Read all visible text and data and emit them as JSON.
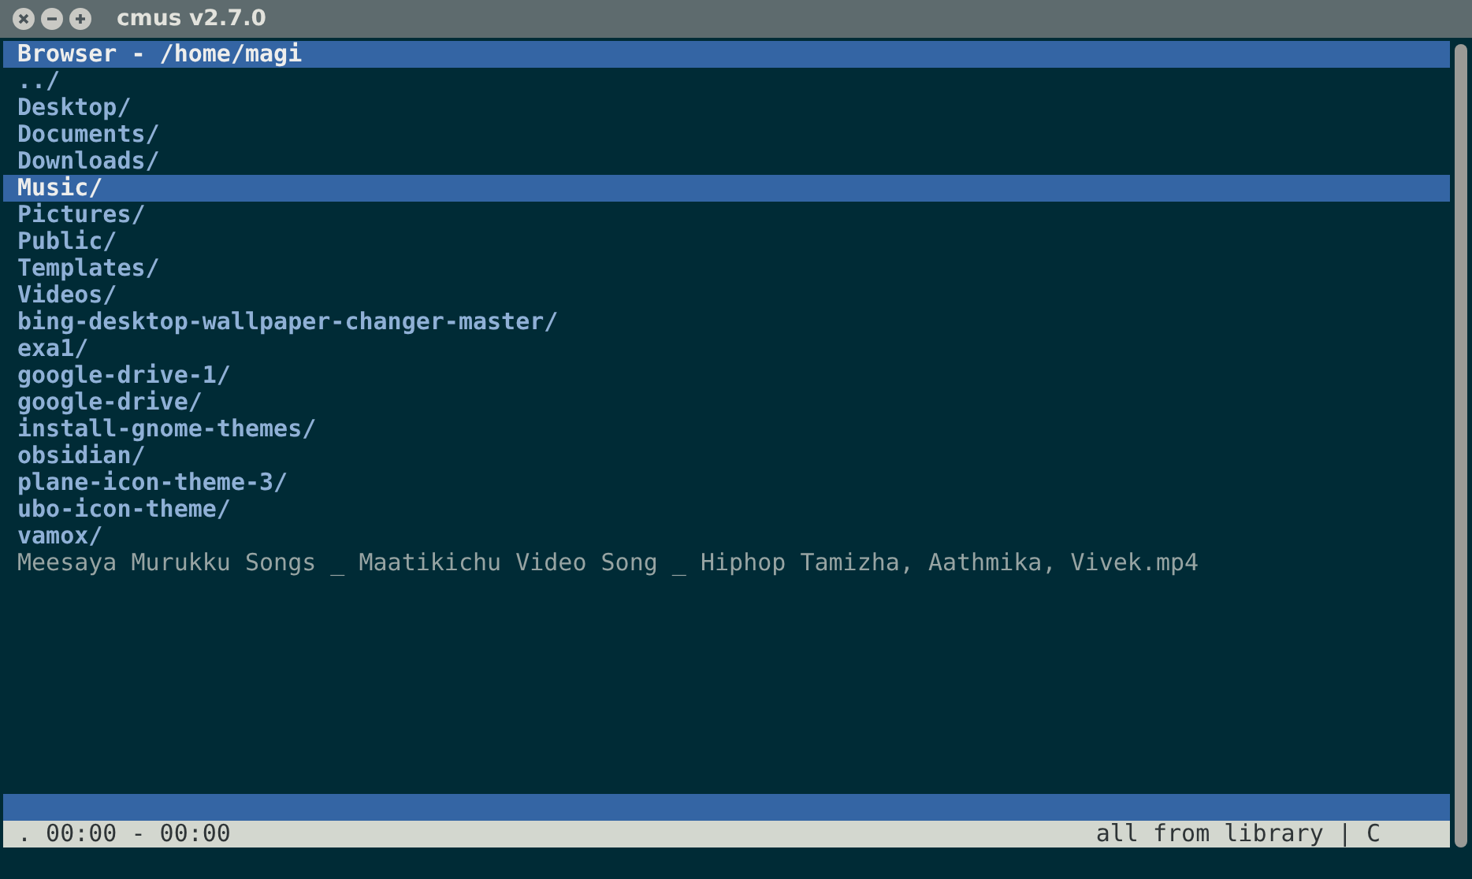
{
  "window": {
    "title": "cmus v2.7.0"
  },
  "header": "Browser - /home/magi",
  "entries": [
    {
      "name": "../",
      "kind": "dir",
      "selected": false
    },
    {
      "name": "Desktop/",
      "kind": "dir",
      "selected": false
    },
    {
      "name": "Documents/",
      "kind": "dir",
      "selected": false
    },
    {
      "name": "Downloads/",
      "kind": "dir",
      "selected": false
    },
    {
      "name": "Music/",
      "kind": "dir",
      "selected": true
    },
    {
      "name": "Pictures/",
      "kind": "dir",
      "selected": false
    },
    {
      "name": "Public/",
      "kind": "dir",
      "selected": false
    },
    {
      "name": "Templates/",
      "kind": "dir",
      "selected": false
    },
    {
      "name": "Videos/",
      "kind": "dir",
      "selected": false
    },
    {
      "name": "bing-desktop-wallpaper-changer-master/",
      "kind": "dir",
      "selected": false
    },
    {
      "name": "exa1/",
      "kind": "dir",
      "selected": false
    },
    {
      "name": "google-drive-1/",
      "kind": "dir",
      "selected": false
    },
    {
      "name": "google-drive/",
      "kind": "dir",
      "selected": false
    },
    {
      "name": "install-gnome-themes/",
      "kind": "dir",
      "selected": false
    },
    {
      "name": "obsidian/",
      "kind": "dir",
      "selected": false
    },
    {
      "name": "plane-icon-theme-3/",
      "kind": "dir",
      "selected": false
    },
    {
      "name": "ubo-icon-theme/",
      "kind": "dir",
      "selected": false
    },
    {
      "name": "vamox/",
      "kind": "dir",
      "selected": false
    },
    {
      "name": "Meesaya Murukku Songs _ Maatikichu Video Song _ Hiphop Tamizha, Aathmika, Vivek.mp4",
      "kind": "file",
      "selected": false
    }
  ],
  "status": {
    "left": ". 00:00 - 00:00",
    "right": "all from library | C"
  }
}
